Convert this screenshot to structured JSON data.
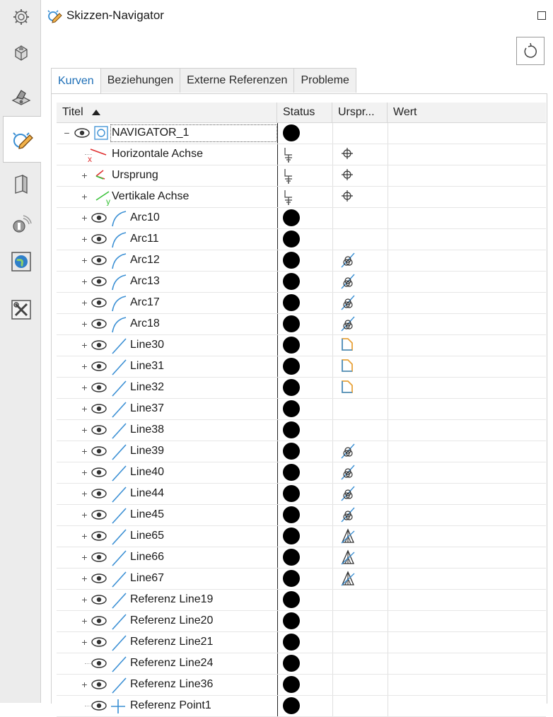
{
  "panel": {
    "title": "Skizzen-Navigator",
    "icons": {
      "title_icon": "sketch-icon",
      "maximize": "maximize-icon",
      "reset": "reset-icon"
    }
  },
  "sidebar": {
    "items": [
      {
        "name": "settings-icon"
      },
      {
        "name": "part-icon"
      },
      {
        "name": "assembly-icon"
      },
      {
        "name": "sketch-navigator-icon",
        "active": true
      },
      {
        "name": "book-icon"
      },
      {
        "name": "sensor-icon"
      },
      {
        "name": "globe-icon"
      },
      {
        "name": "tools-icon"
      }
    ]
  },
  "tabs": [
    {
      "label": "Kurven",
      "active": true
    },
    {
      "label": "Beziehungen"
    },
    {
      "label": "Externe Referenzen"
    },
    {
      "label": "Probleme"
    }
  ],
  "columns": {
    "title": "Titel",
    "status": "Status",
    "origin": "Urspr...",
    "value": "Wert"
  },
  "colors": {
    "accent": "#1e6fb7",
    "curve": "#3a8fd4",
    "origin_icon": "#3a8fd4",
    "line_orange": "#e8a23a"
  },
  "rows": [
    {
      "label": "NAVIGATOR_1",
      "depth": 0,
      "expander": "−",
      "eye": true,
      "icon": "navigator",
      "status": "dot",
      "origin": ""
    },
    {
      "label": "Horizontale Achse",
      "depth": 1,
      "expander": "",
      "eye": false,
      "icon": "axis-x",
      "status": "ground",
      "origin": "crosshair"
    },
    {
      "label": "Ursprung",
      "depth": 1,
      "expander": "+",
      "eye": false,
      "icon": "origin",
      "status": "ground",
      "origin": "crosshair"
    },
    {
      "label": "Vertikale Achse",
      "depth": 1,
      "expander": "+",
      "eye": false,
      "icon": "axis-y",
      "status": "ground",
      "origin": "crosshair"
    },
    {
      "label": "Arc10",
      "depth": 1,
      "expander": "+",
      "eye": true,
      "icon": "arc",
      "status": "dot",
      "origin": ""
    },
    {
      "label": "Arc11",
      "depth": 1,
      "expander": "+",
      "eye": true,
      "icon": "arc",
      "status": "dot",
      "origin": ""
    },
    {
      "label": "Arc12",
      "depth": 1,
      "expander": "+",
      "eye": true,
      "icon": "arc",
      "status": "dot",
      "origin": "intersect"
    },
    {
      "label": "Arc13",
      "depth": 1,
      "expander": "+",
      "eye": true,
      "icon": "arc",
      "status": "dot",
      "origin": "intersect"
    },
    {
      "label": "Arc17",
      "depth": 1,
      "expander": "+",
      "eye": true,
      "icon": "arc",
      "status": "dot",
      "origin": "intersect"
    },
    {
      "label": "Arc18",
      "depth": 1,
      "expander": "+",
      "eye": true,
      "icon": "arc",
      "status": "dot",
      "origin": "intersect"
    },
    {
      "label": "Line30",
      "depth": 1,
      "expander": "+",
      "eye": true,
      "icon": "line",
      "status": "dot",
      "origin": "offset"
    },
    {
      "label": "Line31",
      "depth": 1,
      "expander": "+",
      "eye": true,
      "icon": "line",
      "status": "dot",
      "origin": "offset"
    },
    {
      "label": "Line32",
      "depth": 1,
      "expander": "+",
      "eye": true,
      "icon": "line",
      "status": "dot",
      "origin": "offset"
    },
    {
      "label": "Line37",
      "depth": 1,
      "expander": "+",
      "eye": true,
      "icon": "line",
      "status": "dot",
      "origin": ""
    },
    {
      "label": "Line38",
      "depth": 1,
      "expander": "+",
      "eye": true,
      "icon": "line",
      "status": "dot",
      "origin": ""
    },
    {
      "label": "Line39",
      "depth": 1,
      "expander": "+",
      "eye": true,
      "icon": "line",
      "status": "dot",
      "origin": "intersect"
    },
    {
      "label": "Line40",
      "depth": 1,
      "expander": "+",
      "eye": true,
      "icon": "line",
      "status": "dot",
      "origin": "intersect"
    },
    {
      "label": "Line44",
      "depth": 1,
      "expander": "+",
      "eye": true,
      "icon": "line",
      "status": "dot",
      "origin": "intersect"
    },
    {
      "label": "Line45",
      "depth": 1,
      "expander": "+",
      "eye": true,
      "icon": "line",
      "status": "dot",
      "origin": "intersect"
    },
    {
      "label": "Line65",
      "depth": 1,
      "expander": "+",
      "eye": true,
      "icon": "line",
      "status": "dot",
      "origin": "project"
    },
    {
      "label": "Line66",
      "depth": 1,
      "expander": "+",
      "eye": true,
      "icon": "line",
      "status": "dot",
      "origin": "project"
    },
    {
      "label": "Line67",
      "depth": 1,
      "expander": "+",
      "eye": true,
      "icon": "line",
      "status": "dot",
      "origin": "project"
    },
    {
      "label": "Referenz Line19",
      "depth": 1,
      "expander": "+",
      "eye": true,
      "icon": "line",
      "status": "dot",
      "origin": ""
    },
    {
      "label": "Referenz Line20",
      "depth": 1,
      "expander": "+",
      "eye": true,
      "icon": "line",
      "status": "dot",
      "origin": ""
    },
    {
      "label": "Referenz Line21",
      "depth": 1,
      "expander": "+",
      "eye": true,
      "icon": "line",
      "status": "dot",
      "origin": ""
    },
    {
      "label": "Referenz Line24",
      "depth": 1,
      "expander": "",
      "eye": true,
      "icon": "line",
      "status": "dot",
      "origin": ""
    },
    {
      "label": "Referenz Line36",
      "depth": 1,
      "expander": "+",
      "eye": true,
      "icon": "line",
      "status": "dot",
      "origin": ""
    },
    {
      "label": "Referenz Point1",
      "depth": 1,
      "expander": "",
      "eye": true,
      "icon": "point",
      "status": "dot",
      "origin": ""
    }
  ]
}
